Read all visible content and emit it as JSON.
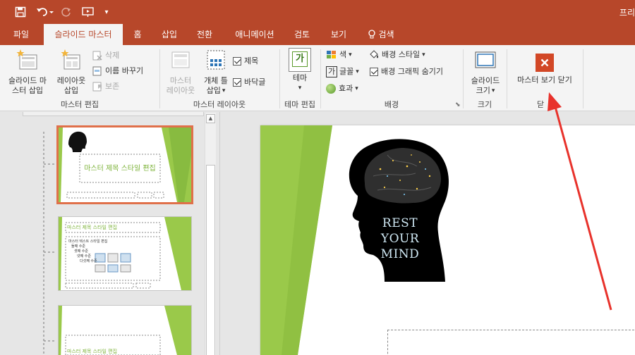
{
  "app": {
    "title_fragment": "프리"
  },
  "tabs": [
    {
      "label": "파일"
    },
    {
      "label": "슬라이드 마스터"
    },
    {
      "label": "홈"
    },
    {
      "label": "삽입"
    },
    {
      "label": "전환"
    },
    {
      "label": "애니메이션"
    },
    {
      "label": "검토"
    },
    {
      "label": "보기"
    },
    {
      "label": "검색"
    }
  ],
  "ribbon": {
    "master_edit": {
      "group": "마스터 편집",
      "insert_slide_master": [
        "슬라이드 마",
        "스터 삽입"
      ],
      "insert_layout": [
        "레이아웃",
        "삽입"
      ],
      "delete": "삭제",
      "rename": "이름 바꾸기",
      "preserve": "보존"
    },
    "master_layout": {
      "group": "마스터 레이아웃",
      "master_layout": [
        "마스터",
        "레이아웃"
      ],
      "insert_placeholder": [
        "개체 틀",
        "삽입"
      ],
      "title_check": "제목",
      "footer_check": "바닥글"
    },
    "theme_edit": {
      "group": "테마 편집",
      "theme": "테마",
      "icon_text": "가"
    },
    "background": {
      "group": "배경",
      "colors": "색",
      "fonts": "글꼴",
      "font_icon": "가",
      "effects": "효과",
      "bg_styles": "배경 스타일",
      "hide_bg_graphics": "배경 그래픽 숨기기"
    },
    "size": {
      "group": "크기",
      "slide_size": [
        "슬라이드",
        "크기"
      ]
    },
    "close": {
      "group": "닫",
      "close_master_view": "마스터 보기 닫기"
    }
  },
  "thumbnails": [
    {
      "title": "마스터 제목 스타일 편집",
      "selected": true
    },
    {
      "title": "마스터 제목 스타일 편집",
      "body": "마스터 텍스트 스타일 편집",
      "levels": [
        "둘째 수준",
        "셋째 수준",
        "넷째 수준",
        "다섯째 수준"
      ],
      "selected": false
    },
    {
      "title": "마스터 제목 스타일 편집",
      "selected": false
    }
  ],
  "slide": {
    "image_text": [
      "REST",
      "YOUR",
      "MIND"
    ]
  },
  "colors": {
    "accent": "#b7472a",
    "green": "#9ac94a",
    "arrow": "#e8322b"
  }
}
